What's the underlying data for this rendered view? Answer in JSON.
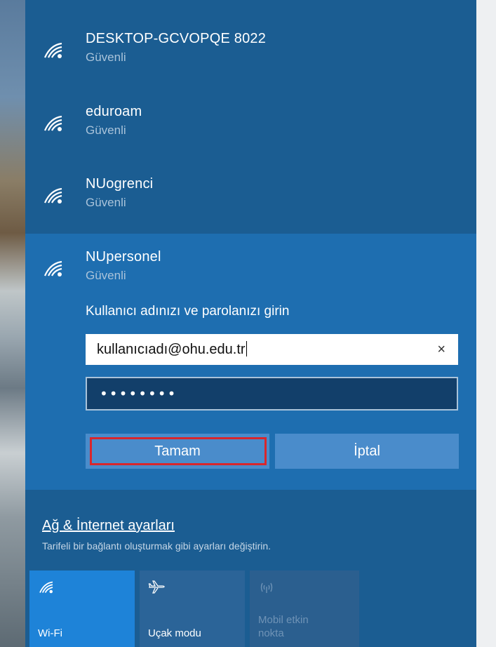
{
  "networks": [
    {
      "name": "DESKTOP-GCVOPQE 8022",
      "status": "Güvenli"
    },
    {
      "name": "eduroam",
      "status": "Güvenli"
    },
    {
      "name": "NUogrenci",
      "status": "Güvenli"
    }
  ],
  "selected_network": {
    "name": "NUpersonel",
    "status": "Güvenli",
    "prompt": "Kullanıcı adınızı ve parolanızı girin",
    "username_value": "kullanıcıadı@ohu.edu.tr",
    "clear_glyph": "×",
    "password_mask": "••••••••",
    "ok_label": "Tamam",
    "cancel_label": "İptal"
  },
  "settings": {
    "link": "Ağ & İnternet ayarları",
    "description": "Tarifeli bir bağlantı oluşturmak gibi ayarları değiştirin."
  },
  "quick_actions": [
    {
      "label": "Wi-Fi",
      "icon": "wifi-icon",
      "state": "on"
    },
    {
      "label": "Uçak modu",
      "icon": "airplane-icon",
      "state": "off"
    },
    {
      "label": "Mobil etkin nokta",
      "label_line1": "Mobil etkin",
      "label_line2": "nokta",
      "icon": "hotspot-icon",
      "state": "disabled"
    }
  ],
  "colors": {
    "flyout_bg": "#1b5d92",
    "expanded_bg": "#1e6eb0",
    "button_bg": "#4a8ccb",
    "highlight_outline": "#d9262c",
    "wifi_tile_active": "#1e83d8"
  }
}
